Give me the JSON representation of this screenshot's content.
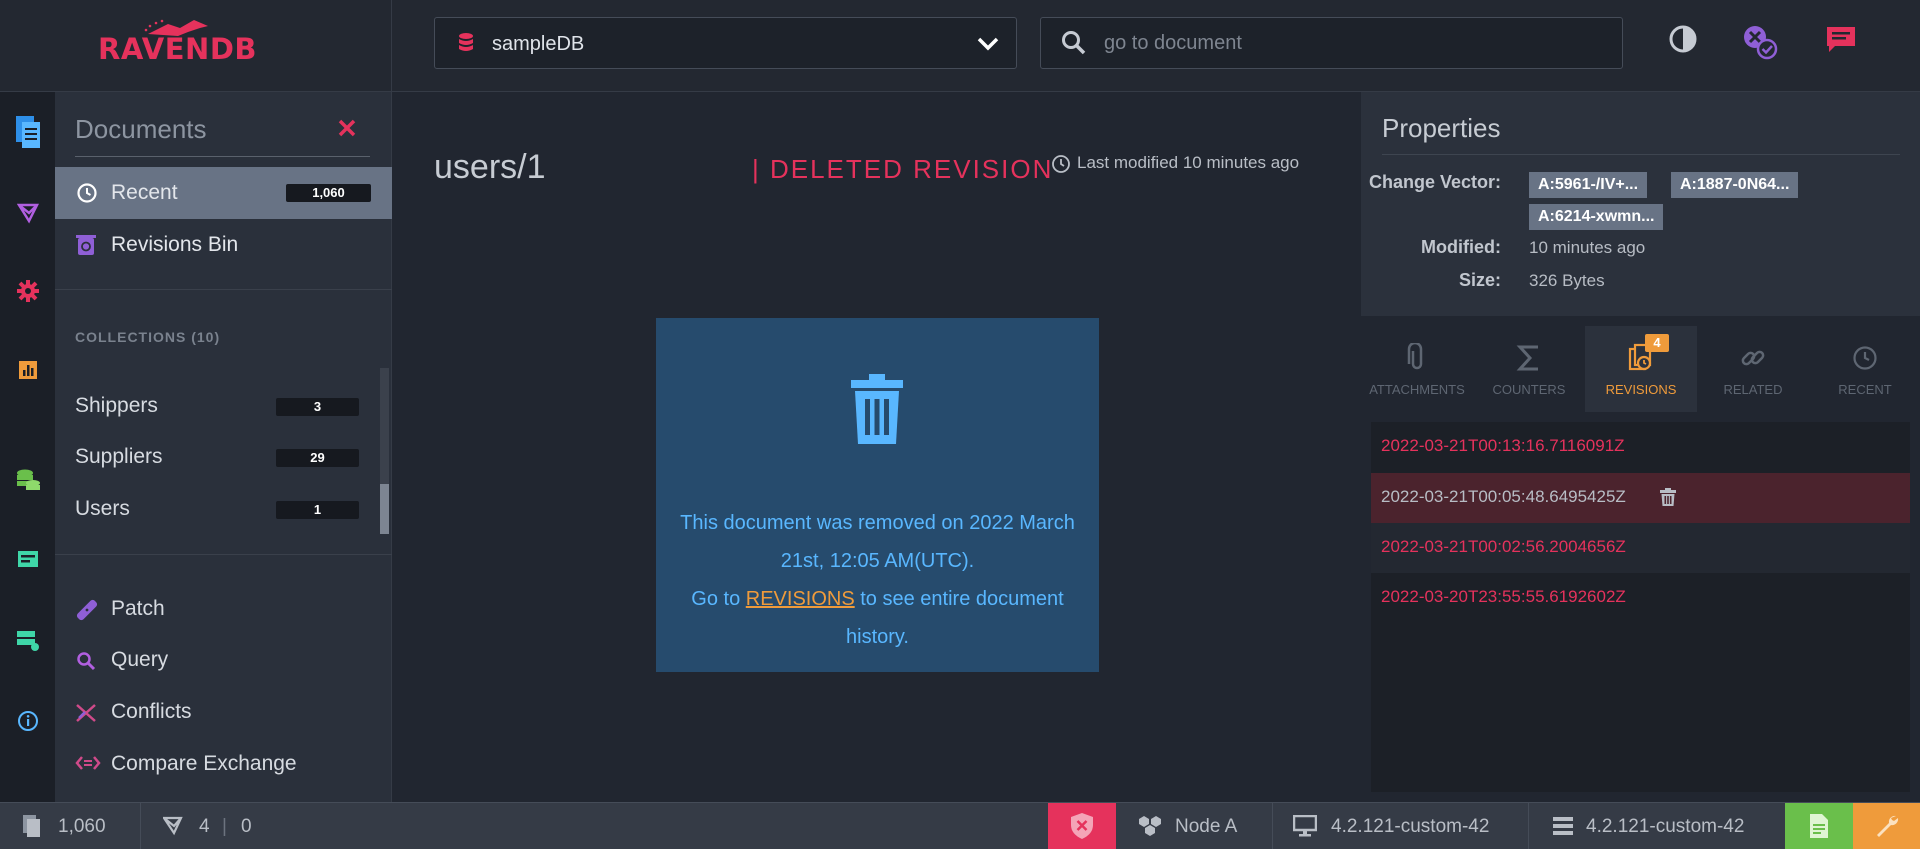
{
  "app": {
    "logo_text": "RAVENDB"
  },
  "header": {
    "database": "sampleDB",
    "search_placeholder": "go to document"
  },
  "sidebar": {
    "title": "Documents",
    "items": [
      {
        "label": "Recent",
        "count": "1,060"
      },
      {
        "label": "Revisions Bin"
      }
    ],
    "collections_title": "COLLECTIONS (10)",
    "collections": [
      {
        "label": "Shippers",
        "count": "3"
      },
      {
        "label": "Suppliers",
        "count": "29"
      },
      {
        "label": "Users",
        "count": "1"
      }
    ],
    "tools": [
      {
        "label": "Patch"
      },
      {
        "label": "Query"
      },
      {
        "label": "Conflicts"
      },
      {
        "label": "Compare Exchange"
      }
    ]
  },
  "document": {
    "id": "users/1",
    "state": "| DELETED REVISION",
    "last_modified": "Last modified 10 minutes ago",
    "message_line1": "This document was removed on   2022 March 21st, 12:05 AM(UTC).",
    "message_go": "Go to ",
    "message_link": "REVISIONS",
    "message_rest": " to see entire document history."
  },
  "properties": {
    "title": "Properties",
    "change_vector_label": "Change Vector:",
    "change_vector": [
      "A:5961-/IV+...",
      "A:1887-0N64...",
      "A:6214-xwmn..."
    ],
    "modified_label": "Modified:",
    "modified": "10 minutes ago",
    "size_label": "Size:",
    "size": "326 Bytes"
  },
  "tabs": [
    {
      "label": "ATTACHMENTS"
    },
    {
      "label": "COUNTERS"
    },
    {
      "label": "REVISIONS",
      "count": "4",
      "active": true
    },
    {
      "label": "RELATED"
    },
    {
      "label": "RECENT"
    }
  ],
  "revisions": [
    "2022-03-21T00:13:16.7116091Z",
    "2022-03-21T00:05:48.6495425Z",
    "2022-03-21T00:02:56.2004656Z",
    "2022-03-20T23:55:55.6192602Z"
  ],
  "statusbar": {
    "docs": "1,060",
    "indexes": "4",
    "index_errors": "0",
    "node": "Node A",
    "client_version": "4.2.121-custom-42",
    "server_version": "4.2.121-custom-42"
  },
  "colors": {
    "accent": "#e5325c",
    "orange": "#ef9b3b",
    "info_blue": "#59b7ff",
    "panel_bg": "#264b6d"
  }
}
